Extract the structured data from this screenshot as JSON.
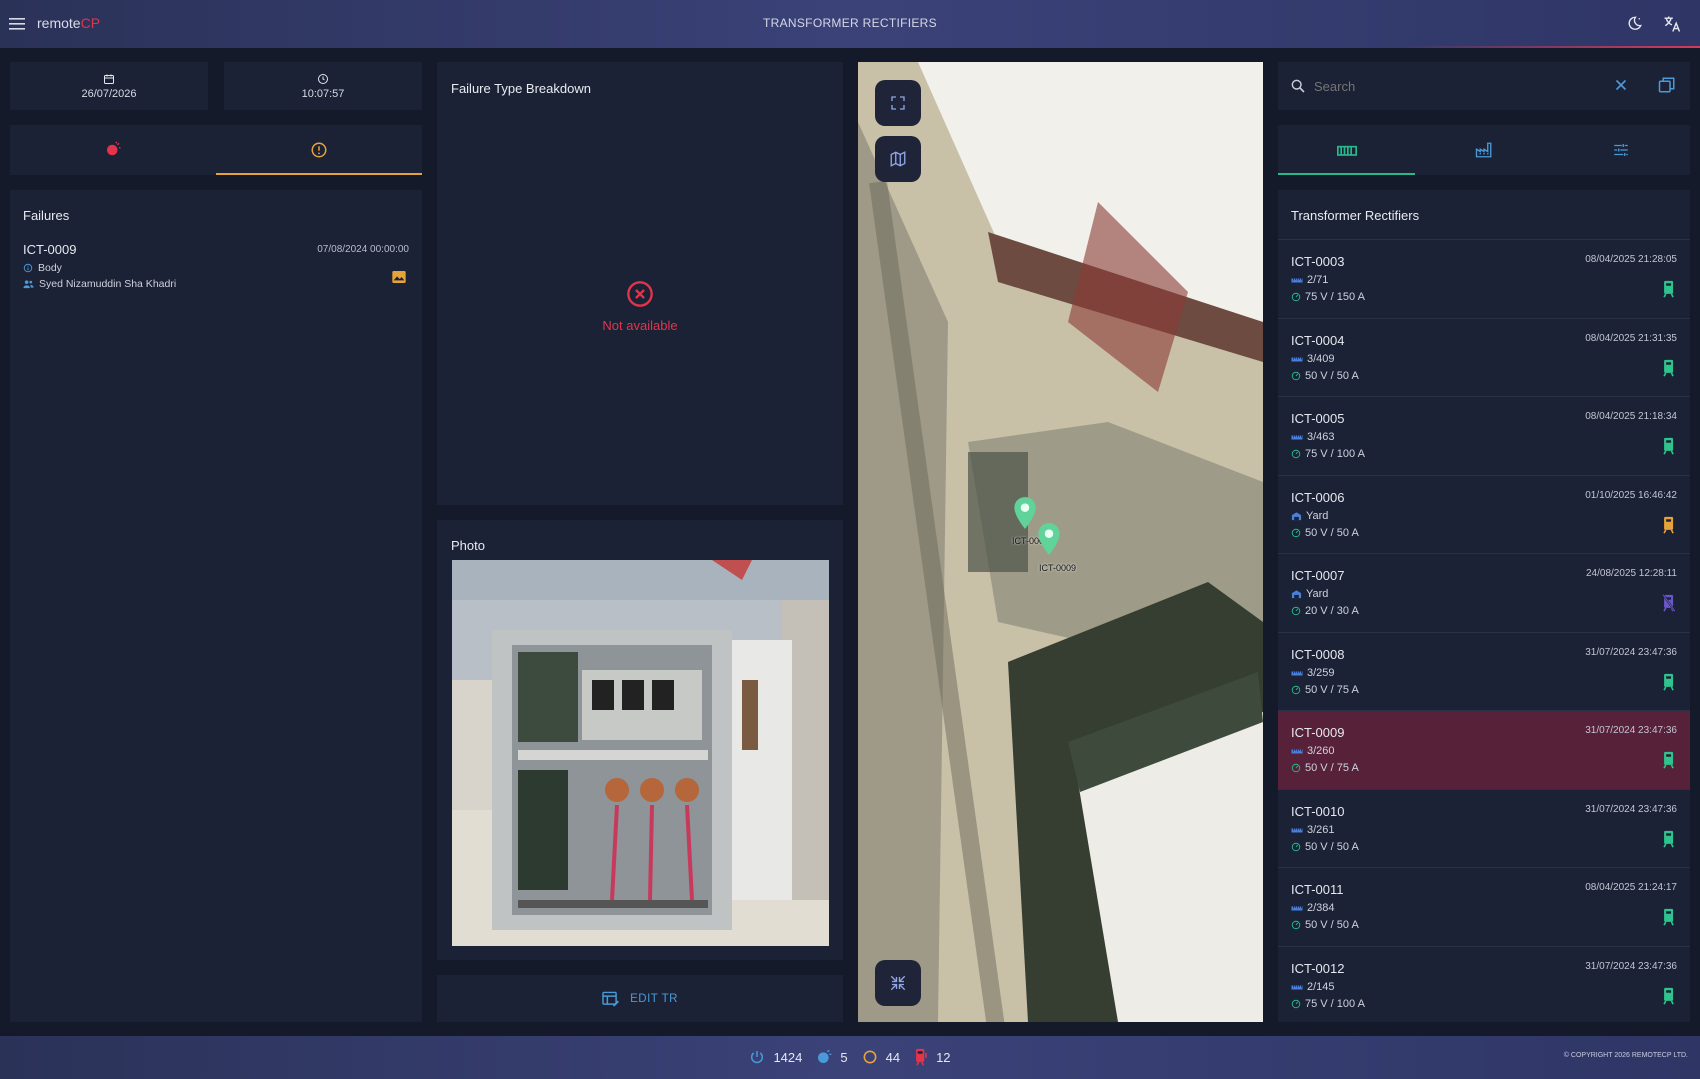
{
  "header": {
    "brand_main": "remote",
    "brand_accent": "CP",
    "title": "TRANSFORMER RECTIFIERS"
  },
  "datetime": {
    "date": "26/07/2026",
    "time": "10:07:57"
  },
  "failures": {
    "title": "Failures",
    "items": [
      {
        "id": "ICT-0009",
        "date": "07/08/2024 00:00:00",
        "type": "Body",
        "person": "Syed Nizamuddin Sha Khadri"
      }
    ]
  },
  "breakdown": {
    "title": "Failure Type Breakdown",
    "empty_text": "Not available"
  },
  "photo": {
    "title": "Photo"
  },
  "edit": {
    "label": "EDIT TR"
  },
  "map": {
    "markers": [
      "ICT-0008",
      "ICT-0009"
    ]
  },
  "search": {
    "placeholder": "Search"
  },
  "tr_list": {
    "title": "Transformer Rectifiers",
    "rows": [
      {
        "id": "ICT-0003",
        "date": "08/04/2025 21:28:05",
        "loc": "2/71",
        "loc_type": "ruler",
        "rating": "75 V / 150 A",
        "status": "green"
      },
      {
        "id": "ICT-0004",
        "date": "08/04/2025 21:31:35",
        "loc": "3/409",
        "loc_type": "ruler",
        "rating": "50 V / 50 A",
        "status": "green"
      },
      {
        "id": "ICT-0005",
        "date": "08/04/2025 21:18:34",
        "loc": "3/463",
        "loc_type": "ruler",
        "rating": "75 V / 100 A",
        "status": "green"
      },
      {
        "id": "ICT-0006",
        "date": "01/10/2025 16:46:42",
        "loc": "Yard",
        "loc_type": "yard",
        "rating": "50 V / 50 A",
        "status": "orange"
      },
      {
        "id": "ICT-0007",
        "date": "24/08/2025 12:28:11",
        "loc": "Yard",
        "loc_type": "yard",
        "rating": "20 V / 30 A",
        "status": "off"
      },
      {
        "id": "ICT-0008",
        "date": "31/07/2024 23:47:36",
        "loc": "3/259",
        "loc_type": "ruler",
        "rating": "50 V / 75 A",
        "status": "green"
      },
      {
        "id": "ICT-0009",
        "date": "31/07/2024 23:47:36",
        "loc": "3/260",
        "loc_type": "ruler",
        "rating": "50 V / 75 A",
        "status": "green"
      },
      {
        "id": "ICT-0010",
        "date": "31/07/2024 23:47:36",
        "loc": "3/261",
        "loc_type": "ruler",
        "rating": "50 V / 50 A",
        "status": "green"
      },
      {
        "id": "ICT-0011",
        "date": "08/04/2025 21:24:17",
        "loc": "2/384",
        "loc_type": "ruler",
        "rating": "50 V / 50 A",
        "status": "green"
      },
      {
        "id": "ICT-0012",
        "date": "31/07/2024 23:47:36",
        "loc": "2/145",
        "loc_type": "ruler",
        "rating": "75 V / 100 A",
        "status": "green"
      }
    ]
  },
  "footer": {
    "stat_power": "1424",
    "stat_alarm": "5",
    "stat_circle": "44",
    "stat_fault": "12",
    "copyright": "© COPYRIGHT 2026 REMOTECP LTD."
  },
  "colors": {
    "accent_red": "#e3344c",
    "accent_orange": "#e6a33a",
    "accent_green": "#27b98a",
    "link_blue": "#4a9ad9",
    "selected_row": "#57213a"
  }
}
